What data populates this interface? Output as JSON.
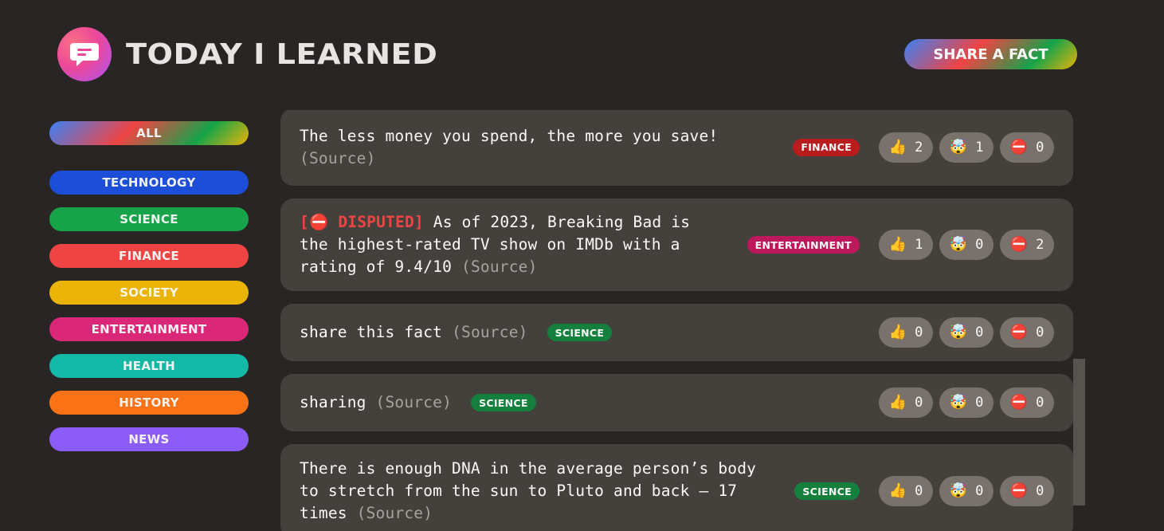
{
  "app": {
    "title": "Today I Learned",
    "share_label": "Share a fact"
  },
  "categories": [
    {
      "label": "All",
      "color": "all"
    },
    {
      "label": "technology",
      "color": "#1d4ed8"
    },
    {
      "label": "science",
      "color": "#16a34a"
    },
    {
      "label": "finance",
      "color": "#ef4444"
    },
    {
      "label": "society",
      "color": "#eab308"
    },
    {
      "label": "entertainment",
      "color": "#db2777"
    },
    {
      "label": "health",
      "color": "#14b8a6"
    },
    {
      "label": "history",
      "color": "#f97316"
    },
    {
      "label": "news",
      "color": "#8b5cf6"
    }
  ],
  "facts": [
    {
      "text": "The less money you spend, the more you save!",
      "source": "(Source)",
      "disputed": "",
      "category": "finance",
      "category_color": "#b91c1c",
      "votes": {
        "interesting": "2",
        "mindblowing": "1",
        "false": "0"
      }
    },
    {
      "text": "As of 2023, Breaking Bad is the highest-rated TV show on IMDb with a rating of 9.4/10",
      "source": "(Source)",
      "disputed": "[⛔ DISPUTED]",
      "category": "entertainment",
      "category_color": "#be185d",
      "votes": {
        "interesting": "1",
        "mindblowing": "0",
        "false": "2"
      }
    },
    {
      "text": "share this fact",
      "source": "(Source)",
      "disputed": "",
      "category": "science",
      "category_color": "#15803d",
      "votes": {
        "interesting": "0",
        "mindblowing": "0",
        "false": "0"
      }
    },
    {
      "text": "sharing",
      "source": "(Source)",
      "disputed": "",
      "category": "science",
      "category_color": "#15803d",
      "votes": {
        "interesting": "0",
        "mindblowing": "0",
        "false": "0"
      }
    },
    {
      "text": "There is enough DNA in the average person’s body to stretch from the sun to Pluto and back — 17 times",
      "source": "(Source)",
      "disputed": "",
      "category": "science",
      "category_color": "#15803d",
      "votes": {
        "interesting": "0",
        "mindblowing": "0",
        "false": "0"
      }
    }
  ],
  "icons": {
    "logo": "chat-bubble-icon",
    "interesting": "👍",
    "mindblowing": "🤯",
    "false": "⛔"
  }
}
